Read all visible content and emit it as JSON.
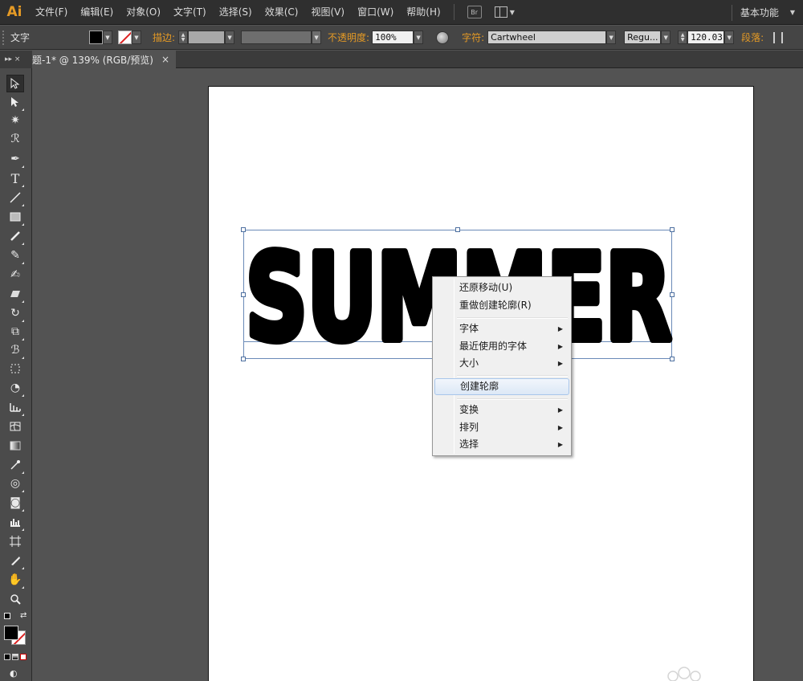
{
  "app": {
    "logo": "Ai"
  },
  "menu": {
    "items": [
      "文件(F)",
      "编辑(E)",
      "对象(O)",
      "文字(T)",
      "选择(S)",
      "效果(C)",
      "视图(V)",
      "窗口(W)",
      "帮助(H)"
    ],
    "bridge_label": "Br",
    "workspace": "基本功能"
  },
  "control": {
    "tool_label": "文字",
    "stroke_label": "描边:",
    "opacity_label": "不透明度:",
    "opacity_value": "100%",
    "character_label": "字符:",
    "font_family": "Cartwheel",
    "font_style": "Regu...",
    "font_size": "120.03",
    "paragraph_label": "段落:"
  },
  "document": {
    "panel_tab_glyphs": "▸▸ ×",
    "tab_title": "题-1* @ 139% (RGB/预览)",
    "close_glyph": "×"
  },
  "artwork": {
    "text": "SUMMER",
    "fill": "#000000"
  },
  "context_menu": {
    "items": [
      {
        "label": "还原移动(U)",
        "submenu": false
      },
      {
        "label": "重做创建轮廓(R)",
        "submenu": false
      },
      {
        "label": "字体",
        "submenu": true
      },
      {
        "label": "最近使用的字体",
        "submenu": true
      },
      {
        "label": "大小",
        "submenu": true
      },
      {
        "label": "创建轮廓",
        "submenu": false,
        "hover": true
      },
      {
        "label": "变换",
        "submenu": true
      },
      {
        "label": "排列",
        "submenu": true
      },
      {
        "label": "选择",
        "submenu": true
      }
    ]
  },
  "colors": {
    "accent": "#e59a25",
    "menubar": "#2f2f2f",
    "controlbar": "#454545",
    "pasteboard": "#535353",
    "selection": "#6a8ab8"
  }
}
